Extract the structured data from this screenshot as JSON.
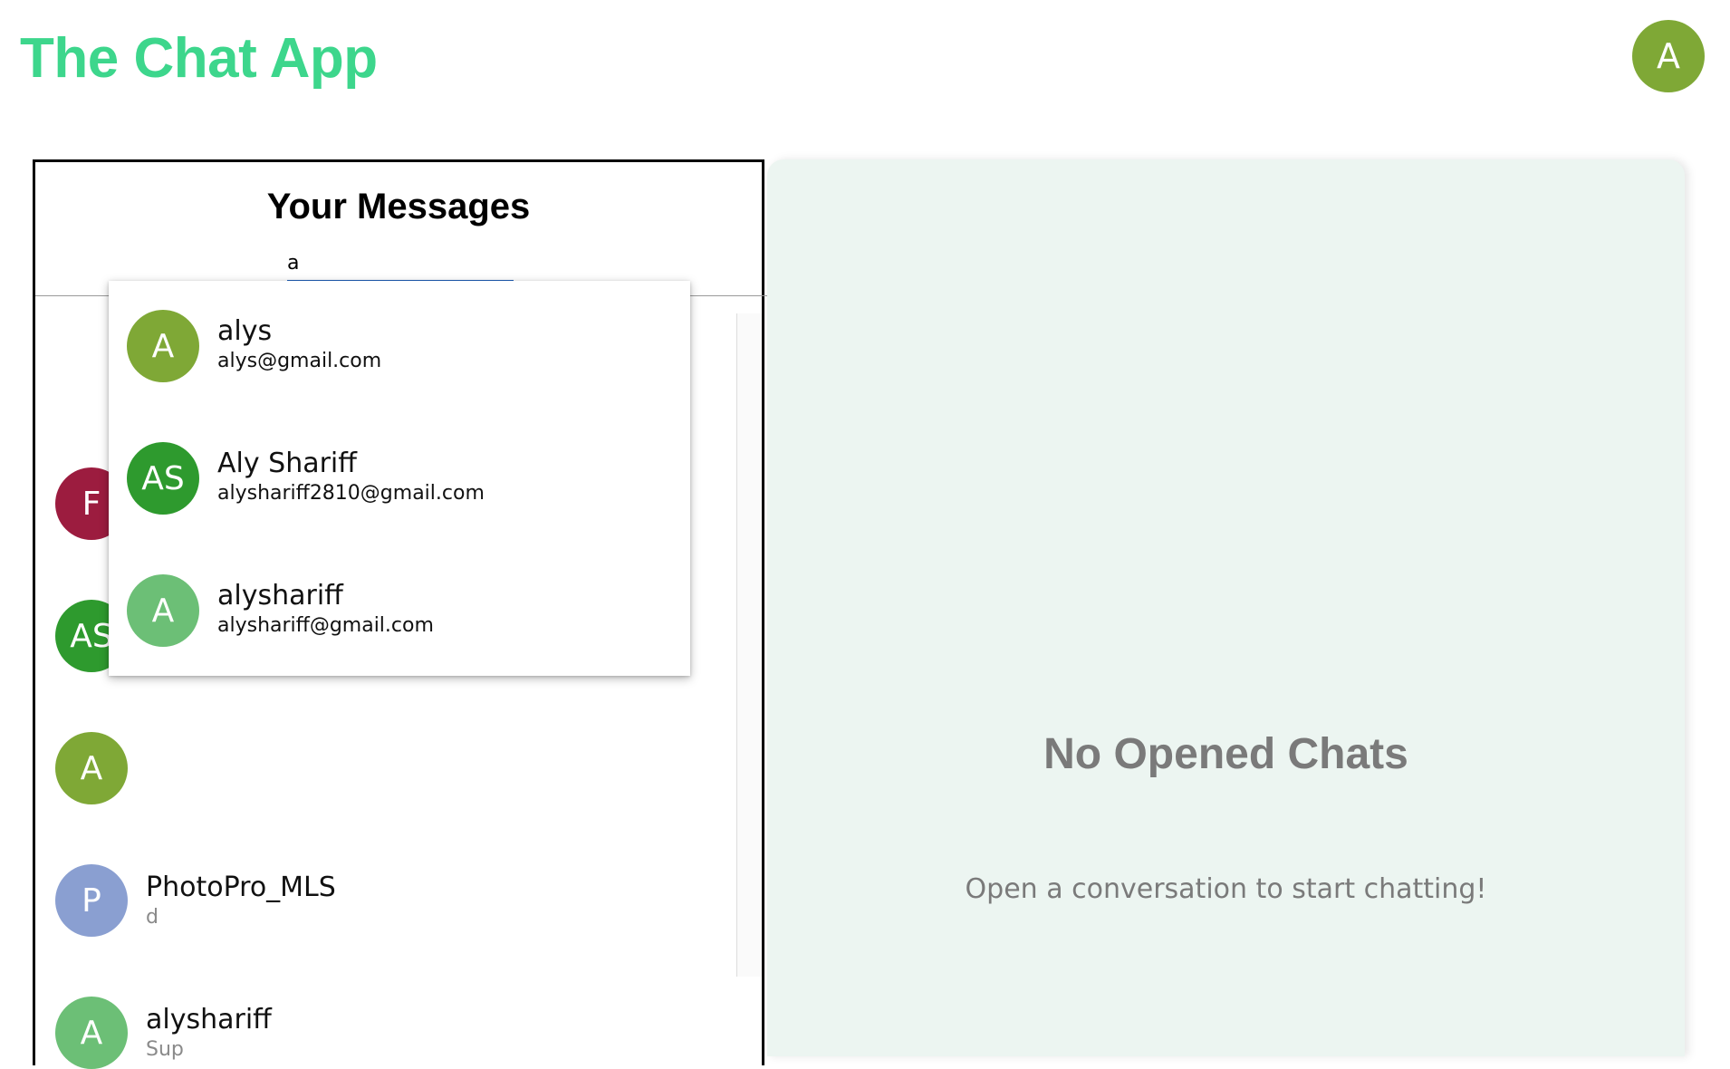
{
  "header": {
    "app_title": "The Chat App",
    "user_avatar_initials": "A",
    "title_color": "#3dd68c"
  },
  "messages_panel": {
    "title": "Your Messages",
    "search": {
      "value": "a",
      "placeholder": ""
    },
    "conversations": [
      {
        "initials": "F",
        "name": "",
        "preview": "",
        "color": "#9c1c3f"
      },
      {
        "initials": "AS",
        "name": "",
        "preview": "",
        "color": "#2e9a2e"
      },
      {
        "initials": "A",
        "name": "",
        "preview": "",
        "color": "#7fa836"
      },
      {
        "initials": "P",
        "name": "PhotoPro_MLS",
        "preview": "d",
        "color": "#8a9fd1"
      },
      {
        "initials": "A",
        "name": "alyshariff",
        "preview": "Sup",
        "color": "#6cbf76"
      }
    ]
  },
  "search_results": [
    {
      "initials": "A",
      "name": "alys",
      "email": "alys@gmail.com",
      "color": "#7fa836"
    },
    {
      "initials": "AS",
      "name": "Aly Shariff",
      "email": "alyshariff2810@gmail.com",
      "color": "#2e9a2e"
    },
    {
      "initials": "A",
      "name": "alyshariff",
      "email": "alyshariff@gmail.com",
      "color": "#6cbf76"
    }
  ],
  "chat_area": {
    "empty_title": "No Opened Chats",
    "empty_subtitle": "Open a conversation to start chatting!"
  },
  "colors": {
    "user_avatar": "#7fa836",
    "chat_area_background": "#ecf5f1",
    "search_underline": "#1e5fb8"
  }
}
